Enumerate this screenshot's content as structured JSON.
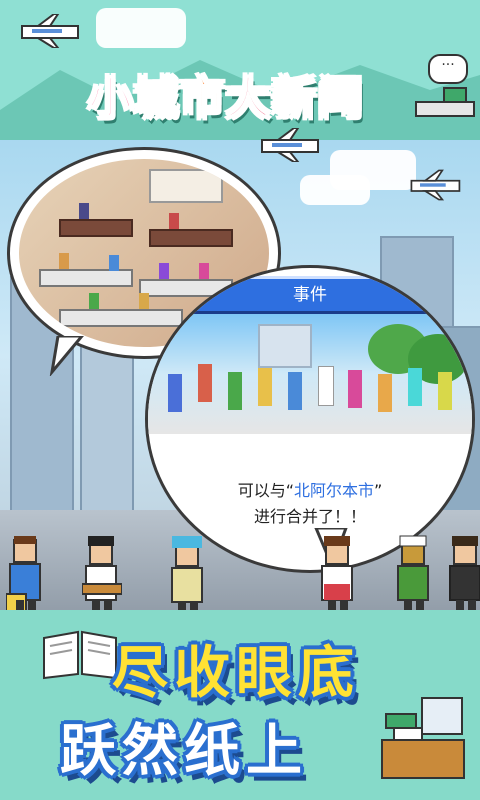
{
  "title": {
    "chars": [
      "小",
      "城",
      "市",
      "大",
      "新",
      "闻"
    ]
  },
  "speech_icon": {
    "text": "···"
  },
  "event_panel": {
    "header": "事件",
    "message_prefix": "可以与“",
    "message_city": "北阿尔本市",
    "message_suffix": "”",
    "message_line2": "进行合并了！！"
  },
  "slogans": {
    "line1": "尽收眼底",
    "line2": "跃然纸上"
  },
  "colors": {
    "accent_blue": "#2e6fe0",
    "title_orange": "#ff8a2a",
    "slogan_yellow": "#ffe234"
  }
}
